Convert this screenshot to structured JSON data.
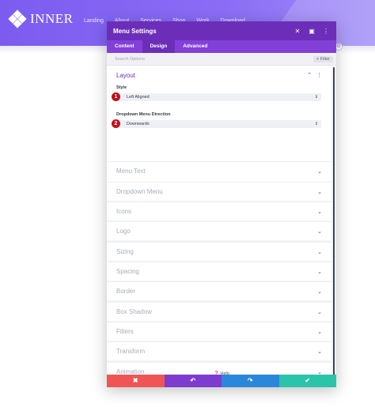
{
  "site": {
    "logo_text": "INNER",
    "nav": [
      "Landing",
      "About",
      "Services",
      "Shop",
      "Work",
      "Download"
    ]
  },
  "modal": {
    "title": "Menu Settings",
    "titlebar_icons": [
      "close-icon",
      "responsive-icon",
      "more-icon"
    ],
    "tabs": [
      "Content",
      "Design",
      "Advanced"
    ],
    "active_tab": "Design",
    "search_placeholder": "Search Options",
    "filter_label": "+ Filter",
    "open_panel": {
      "title": "Layout",
      "fields": [
        {
          "label": "Style",
          "value": "Left Aligned",
          "badge": "1"
        },
        {
          "label": "Dropdown Menu Direction",
          "value": "Downwards",
          "badge": "2"
        }
      ]
    },
    "panels": [
      "Menu Text",
      "Dropdown Menu",
      "Icons",
      "Logo",
      "Sizing",
      "Spacing",
      "Border",
      "Box Shadow",
      "Filters",
      "Transform",
      "Animation"
    ],
    "help_label": "Help",
    "actions": [
      {
        "name": "discard",
        "glyph": "✖",
        "color": "#ef5555"
      },
      {
        "name": "undo",
        "glyph": "↶",
        "color": "#7d3bcf"
      },
      {
        "name": "redo",
        "glyph": "↷",
        "color": "#2b87da"
      },
      {
        "name": "save",
        "glyph": "✔",
        "color": "#29c4a9"
      }
    ]
  },
  "colors": {
    "header": "#7b5cf0",
    "titlebar": "#6c2eb9",
    "tabs": "#8240d8",
    "badge": "#c0101a"
  }
}
